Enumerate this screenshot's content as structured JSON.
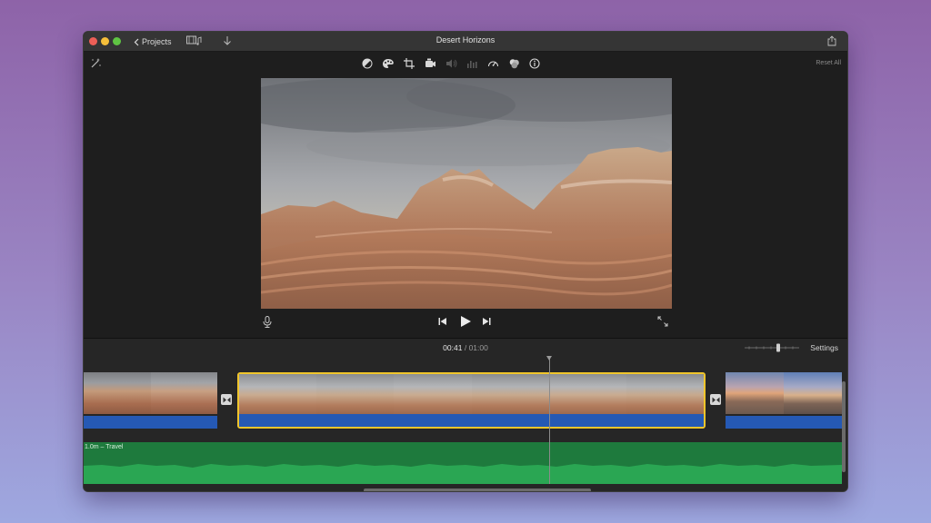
{
  "window": {
    "title": "Desert Horizons",
    "back_label": "Projects"
  },
  "toolbar": {
    "reset_label": "Reset All",
    "tools": [
      "color-balance-icon",
      "color-palette-icon",
      "crop-icon",
      "stabilize-camera-icon",
      "volume-icon",
      "equalizer-icon",
      "speed-icon",
      "filter-icon",
      "info-icon"
    ]
  },
  "playback": {
    "current_time": "00:41",
    "separator": "/",
    "total_time": "01:00"
  },
  "timeline": {
    "settings_label": "Settings",
    "music_label": "1.0m – Travel"
  },
  "colors": {
    "accent_clip_border": "#f0c52b",
    "audio_blue": "#2559b4",
    "music_green": "#1e7a3d"
  }
}
